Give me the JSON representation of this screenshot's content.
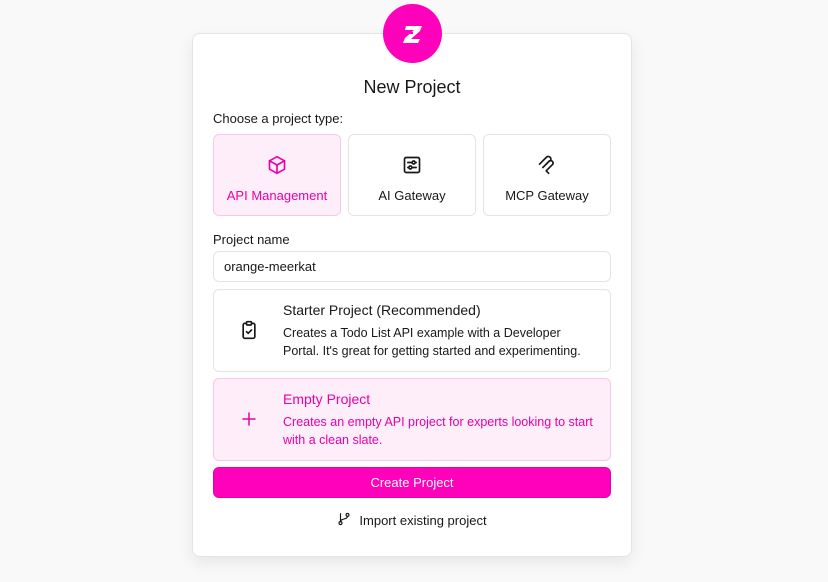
{
  "title": "New Project",
  "type_section": {
    "label": "Choose a project type:",
    "options": [
      {
        "label": "API Management",
        "icon": "box-icon",
        "selected": true
      },
      {
        "label": "AI Gateway",
        "icon": "sliders-icon",
        "selected": false
      },
      {
        "label": "MCP Gateway",
        "icon": "mcp-icon",
        "selected": false
      }
    ]
  },
  "name_field": {
    "label": "Project name",
    "value": "orange-meerkat"
  },
  "templates": [
    {
      "title": "Starter Project (Recommended)",
      "description": "Creates a Todo List API example with a Developer Portal. It's great for getting started and experimenting.",
      "icon": "clipboard-check-icon",
      "selected": false
    },
    {
      "title": "Empty Project",
      "description": "Creates an empty API project for experts looking to start with a clean slate.",
      "icon": "plus-icon",
      "selected": true
    }
  ],
  "create_button": "Create Project",
  "import_link": "Import existing project",
  "colors": {
    "accent": "#ff00bb",
    "accent_text": "#e800a8",
    "selected_bg": "#fdeefa",
    "border": "#e4e4e7"
  }
}
